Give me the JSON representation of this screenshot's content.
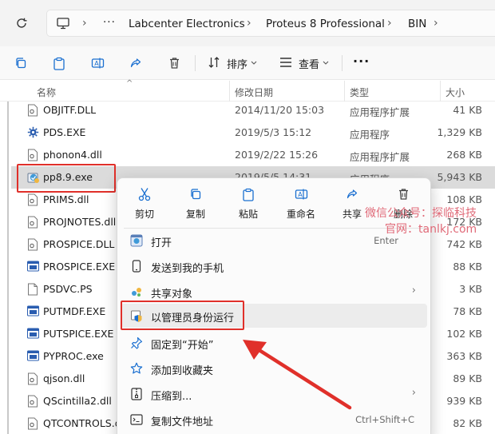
{
  "address": {
    "more": "···",
    "crumbs": [
      "Labcenter Electronics",
      "Proteus 8 Professional",
      "BIN"
    ],
    "separator": "›"
  },
  "toolbar": {
    "sort_label": "排序",
    "view_label": "查看",
    "more": "···"
  },
  "columns": {
    "name": "名称",
    "date": "修改日期",
    "type": "类型",
    "size": "大小"
  },
  "files": [
    {
      "name": "OBJITF.DLL",
      "date": "2014/11/20 15:03",
      "type": "应用程序扩展",
      "size": "41 KB",
      "icon": "dll-icon"
    },
    {
      "name": "PDS.EXE",
      "date": "2019/5/3 15:12",
      "type": "应用程序",
      "size": "1,329 KB",
      "icon": "exe-gear-icon"
    },
    {
      "name": "phonon4.dll",
      "date": "2019/2/22 15:26",
      "type": "应用程序扩展",
      "size": "268 KB",
      "icon": "dll-icon"
    },
    {
      "name": "pp8.9.exe",
      "date": "2019/5/5 14:31",
      "type": "应用程序",
      "size": "5,943 KB",
      "icon": "installer-icon"
    },
    {
      "name": "PRIMS.dll",
      "date": "",
      "type": "",
      "size": "108 KB",
      "icon": "dll-icon"
    },
    {
      "name": "PROJNOTES.dll",
      "date": "",
      "type": "",
      "size": "172 KB",
      "icon": "dll-icon"
    },
    {
      "name": "PROSPICE.DLL",
      "date": "",
      "type": "",
      "size": "742 KB",
      "icon": "dll-icon"
    },
    {
      "name": "PROSPICE.EXE",
      "date": "",
      "type": "",
      "size": "88 KB",
      "icon": "exe-window-icon"
    },
    {
      "name": "PSDVC.PS",
      "date": "",
      "type": "",
      "size": "3 KB",
      "icon": "blank-file-icon"
    },
    {
      "name": "PUTMDF.EXE",
      "date": "",
      "type": "",
      "size": "78 KB",
      "icon": "exe-window-icon"
    },
    {
      "name": "PUTSPICE.EXE",
      "date": "",
      "type": "",
      "size": "102 KB",
      "icon": "exe-window-icon"
    },
    {
      "name": "PYPROC.exe",
      "date": "",
      "type": "",
      "size": "363 KB",
      "icon": "exe-window-icon"
    },
    {
      "name": "qjson.dll",
      "date": "",
      "type": "",
      "size": "89 KB",
      "icon": "dll-icon"
    },
    {
      "name": "QScintilla2.dll",
      "date": "",
      "type": "",
      "size": "939 KB",
      "icon": "dll-icon"
    },
    {
      "name": "QTCONTROLS.dll",
      "date": "",
      "type": "",
      "size": "82 KB",
      "icon": "dll-icon"
    }
  ],
  "context_menu": {
    "quick_actions": [
      {
        "label": "剪切",
        "icon": "scissors-icon"
      },
      {
        "label": "复制",
        "icon": "copy-icon"
      },
      {
        "label": "粘贴",
        "icon": "paste-icon"
      },
      {
        "label": "重命名",
        "icon": "rename-icon"
      },
      {
        "label": "共享",
        "icon": "share-icon"
      },
      {
        "label": "删除",
        "icon": "trash-icon"
      }
    ],
    "items": [
      {
        "label": "打开",
        "shortcut": "Enter",
        "icon": "open-app-icon",
        "arrow": ""
      },
      {
        "label": "发送到我的手机",
        "shortcut": "",
        "icon": "phone-icon",
        "arrow": ""
      },
      {
        "label": "共享对象",
        "shortcut": "",
        "icon": "share-object-icon",
        "arrow": "›"
      },
      {
        "label": "以管理员身份运行",
        "shortcut": "",
        "icon": "shield-icon",
        "arrow": ""
      },
      {
        "label": "固定到“开始”",
        "shortcut": "",
        "icon": "pin-icon",
        "arrow": ""
      },
      {
        "label": "添加到收藏夹",
        "shortcut": "",
        "icon": "star-icon",
        "arrow": ""
      },
      {
        "label": "压缩到...",
        "shortcut": "",
        "icon": "zip-icon",
        "arrow": "›"
      },
      {
        "label": "复制文件地址",
        "shortcut": "Ctrl+Shift+C",
        "icon": "path-icon",
        "arrow": ""
      }
    ]
  },
  "watermark": {
    "line1": "微信公众号：探临科技",
    "line2": "官网：tanlkj.com"
  },
  "colors": {
    "highlight_red": "#e0302a",
    "accent_blue": "#1a6fd0",
    "watermark": "#e06a78"
  }
}
